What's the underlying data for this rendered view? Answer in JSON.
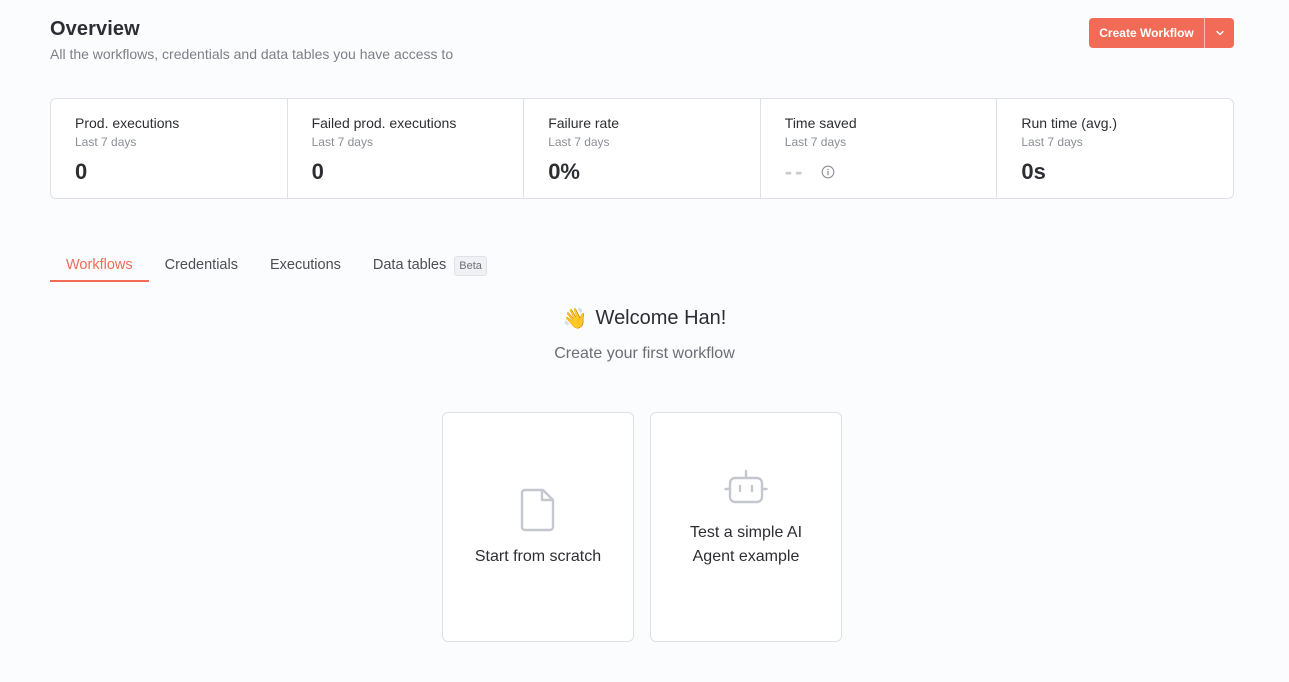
{
  "header": {
    "title": "Overview",
    "subtitle": "All the workflows, credentials and data tables you have access to",
    "create_label": "Create Workflow",
    "create_caret_icon": "chevron-down-icon"
  },
  "stats": [
    {
      "label": "Prod. executions",
      "period": "Last 7 days",
      "value": "0"
    },
    {
      "label": "Failed prod. executions",
      "period": "Last 7 days",
      "value": "0"
    },
    {
      "label": "Failure rate",
      "period": "Last 7 days",
      "value": "0%"
    },
    {
      "label": "Time saved",
      "period": "Last 7 days",
      "value": "--"
    },
    {
      "label": "Run time (avg.)",
      "period": "Last 7 days",
      "value": "0s"
    }
  ],
  "tabs": [
    {
      "label": "Workflows",
      "active": true
    },
    {
      "label": "Credentials"
    },
    {
      "label": "Executions"
    },
    {
      "label": "Data tables",
      "badge": "Beta"
    }
  ],
  "welcome": {
    "emoji": "👋",
    "title": "Welcome Han!",
    "subtitle": "Create your first workflow"
  },
  "cards": [
    {
      "label": "Start from scratch",
      "icon": "file-icon"
    },
    {
      "label_line1": "Test a simple AI",
      "label_line2": "Agent example",
      "icon": "robot-icon"
    }
  ],
  "colors": {
    "accent": "#f26b57",
    "background": "#fbfcfe",
    "border": "#dfe1e6"
  }
}
